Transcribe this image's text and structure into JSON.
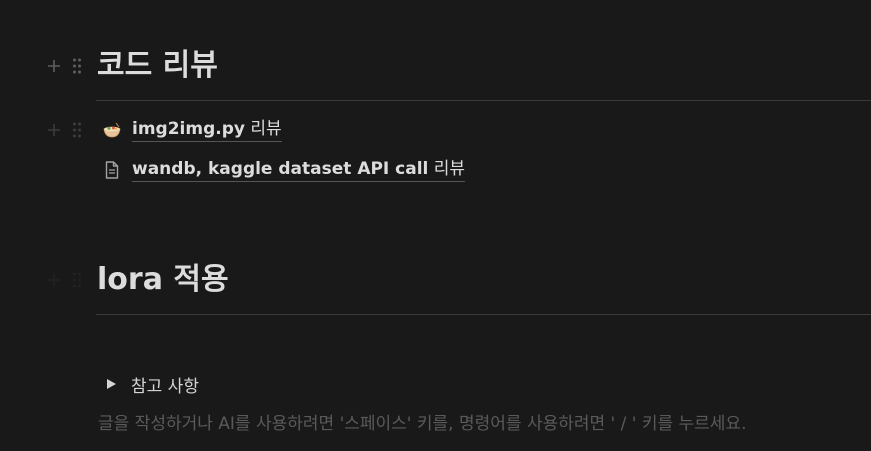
{
  "blocks": [
    {
      "type": "heading",
      "text": "코드 리뷰"
    },
    {
      "type": "links",
      "items": [
        {
          "icon": "bowl-emoji-icon",
          "title_strong": "img2img.py",
          "title_rest": " 리뷰"
        },
        {
          "icon": "document-icon",
          "title_strong": "wandb, kaggle dataset API call",
          "title_rest": " 리뷰"
        }
      ]
    },
    {
      "type": "heading",
      "text": "lora 적용"
    },
    {
      "type": "toggle",
      "label": "참고 사항"
    }
  ],
  "editor": {
    "placeholder": "글을 작성하거나 AI를 사용하려면 '스페이스' 키를, 명령어를 사용하려면 ' / ' 키를 누르세요."
  },
  "colors": {
    "background": "#191919",
    "text": "#d4d4d4",
    "muted": "#5a5a5a",
    "divider": "#3a3a3a"
  }
}
